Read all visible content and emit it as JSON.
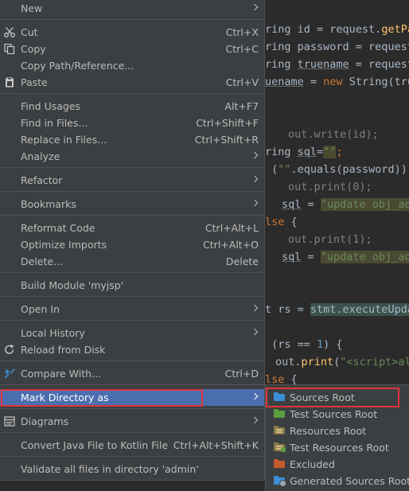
{
  "colors": {
    "menu_bg": "#3c3f41",
    "selection": "#4b6eaf",
    "highlight_box": "#e0353b",
    "sources_folder": "#3c8fd6",
    "test_sources_folder": "#5c9e3f",
    "resources_folder": "#8a7a4a",
    "test_resources_folder": "#8a7a4a",
    "excluded_folder": "#c35b2b",
    "generated_sources_folder": "#3c8fd6"
  },
  "context_menu": {
    "new": {
      "label": "New"
    },
    "cut": {
      "label": "Cut",
      "shortcut": "Ctrl+X",
      "icon": "scissors-icon"
    },
    "copy": {
      "label": "Copy",
      "shortcut": "Ctrl+C",
      "icon": "copy-icon"
    },
    "copy_path": {
      "label": "Copy Path/Reference..."
    },
    "paste": {
      "label": "Paste",
      "shortcut": "Ctrl+V",
      "icon": "clipboard-icon"
    },
    "find_usages": {
      "label": "Find Usages",
      "shortcut": "Alt+F7"
    },
    "find_in_files": {
      "label": "Find in Files...",
      "shortcut": "Ctrl+Shift+F"
    },
    "replace_in_files": {
      "label": "Replace in Files...",
      "shortcut": "Ctrl+Shift+R"
    },
    "analyze": {
      "label": "Analyze"
    },
    "refactor": {
      "label": "Refactor"
    },
    "bookmarks": {
      "label": "Bookmarks"
    },
    "reformat_code": {
      "label": "Reformat Code",
      "shortcut": "Ctrl+Alt+L"
    },
    "optimize_imports": {
      "label": "Optimize Imports",
      "shortcut": "Ctrl+Alt+O"
    },
    "delete": {
      "label": "Delete...",
      "shortcut": "Delete"
    },
    "build_module": {
      "label": "Build Module 'myjsp'"
    },
    "open_in": {
      "label": "Open In"
    },
    "local_history": {
      "label": "Local History"
    },
    "reload_from_disk": {
      "label": "Reload from Disk",
      "icon": "reload-icon"
    },
    "compare_with": {
      "label": "Compare With...",
      "shortcut": "Ctrl+D",
      "icon": "compare-icon"
    },
    "mark_directory_as": {
      "label": "Mark Directory as"
    },
    "diagrams": {
      "label": "Diagrams",
      "icon": "diagram-icon"
    },
    "convert_java": {
      "label": "Convert Java File to Kotlin File",
      "shortcut": "Ctrl+Alt+Shift+K"
    },
    "validate_all": {
      "label": "Validate all files in directory 'admin'"
    }
  },
  "submenu": {
    "items": [
      {
        "label": "Sources Root",
        "icon": "sources-folder-icon"
      },
      {
        "label": "Test Sources Root",
        "icon": "test-sources-folder-icon"
      },
      {
        "label": "Resources Root",
        "icon": "resources-folder-icon"
      },
      {
        "label": "Test Resources Root",
        "icon": "test-resources-folder-icon"
      },
      {
        "label": "Excluded",
        "icon": "excluded-folder-icon"
      },
      {
        "label": "Generated Sources Root",
        "icon": "generated-sources-folder-icon"
      }
    ]
  },
  "editor": {
    "l1": {
      "a": "ring id = request.",
      "b": "getPa"
    },
    "l2": {
      "a": "ring password = request"
    },
    "l3": {
      "a": "ring ",
      "b": "truename",
      "c": " = request"
    },
    "l4": {
      "a": "uename",
      "b": " = ",
      "c": "new",
      "d": " String(tru"
    },
    "l5": {
      "a": "out.write(id);"
    },
    "l6": {
      "a": "ring ",
      "b": "sql",
      "c": "=",
      "d": "\"\"",
      "e": ";"
    },
    "l7": {
      "a": " (",
      "b": "\"\"",
      "c": ".equals(password))"
    },
    "l8": {
      "a": "out.print(0);"
    },
    "l9": {
      "a": "sql",
      "b": " = ",
      "c": "\"update obj_ad"
    },
    "l10": {
      "a": "lse",
      "b": " {"
    },
    "l11": {
      "a": "out.print(1);"
    },
    "l12": {
      "a": "sql",
      "b": " = ",
      "c": "\"update obj_ad"
    },
    "l13": {
      "a": "t rs = ",
      "b": "stmt.executeUpda"
    },
    "l14": {
      "a": " (rs == ",
      "b": "1",
      "c": ") {"
    },
    "l15": {
      "a": "out.",
      "b": "print",
      "c": "(",
      "d": "\"<script>al"
    },
    "l16": {
      "a": "lse",
      "b": " {"
    }
  }
}
